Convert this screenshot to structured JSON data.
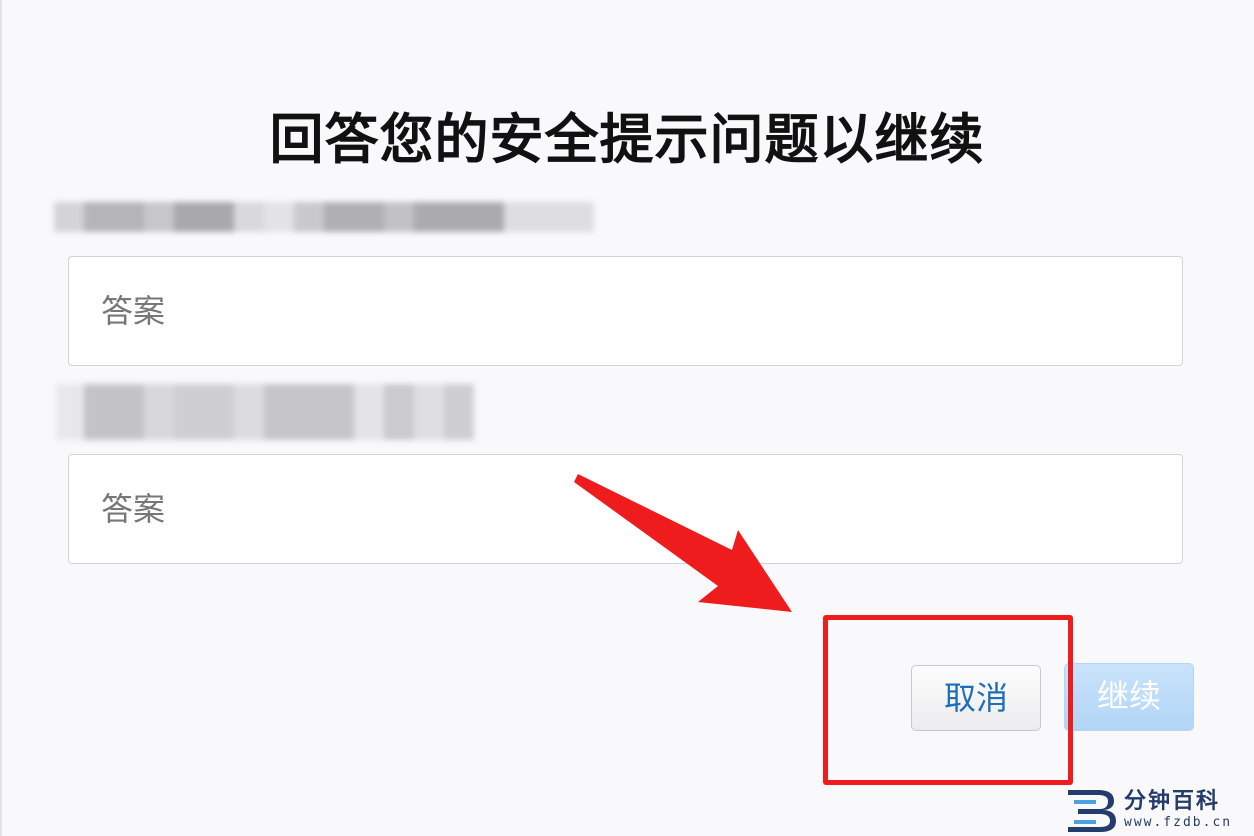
{
  "page": {
    "title": "回答您的安全提示问题以继续"
  },
  "questions": [
    {
      "answer_placeholder": "答案",
      "answer_value": ""
    },
    {
      "answer_placeholder": "答案",
      "answer_value": ""
    }
  ],
  "buttons": {
    "cancel_label": "取消",
    "continue_label": "继续",
    "continue_enabled": false
  },
  "annotation": {
    "color": "#ee1c1c",
    "target": "cancel-button"
  },
  "watermark": {
    "name": "分钟百科",
    "url": "www.fzdb.cn"
  },
  "colors": {
    "accent_text": "#1f6eb8",
    "continue_disabled_bg": "#b2d5f6",
    "title_text": "#111111"
  }
}
